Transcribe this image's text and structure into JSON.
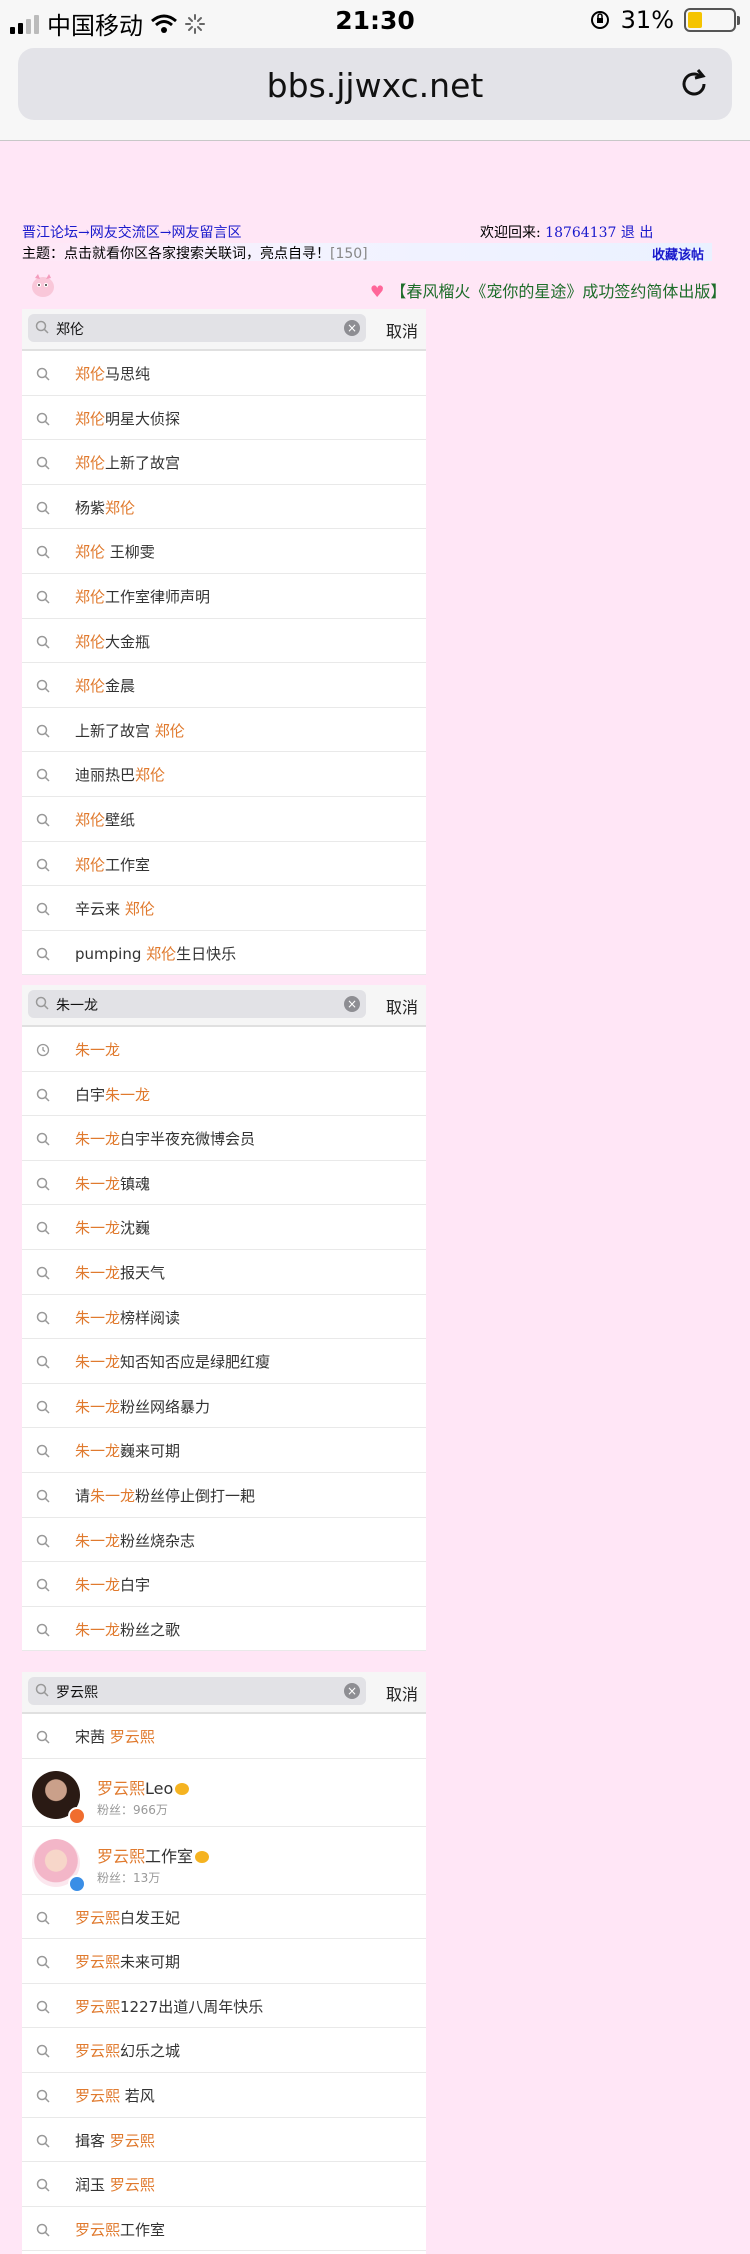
{
  "status_bar": {
    "carrier": "中国移动",
    "time": "21:30",
    "battery": "31%",
    "battery_level": 0.31
  },
  "browser": {
    "url": "bbs.jjwxc.net"
  },
  "forum": {
    "breadcrumb": "晋江论坛→网友交流区→网友留言区",
    "welcome_label": "欢迎回来:",
    "user_id": "18764137",
    "logout": "退 出",
    "topic": "主题：点击就看你区各家搜索关联词，亮点自寻！",
    "topic_count": "[150]",
    "favorite": "收藏该帖",
    "promo": "【春风榴火《宠你的星途》成功签约简体出版】"
  },
  "searches": [
    {
      "query": "郑伦",
      "cancel": "取消",
      "suggestions": [
        {
          "pre": "",
          "hl": "郑伦",
          "post": "马思纯",
          "icon": "search"
        },
        {
          "pre": "",
          "hl": "郑伦",
          "post": "明星大侦探",
          "icon": "search"
        },
        {
          "pre": "",
          "hl": "郑伦",
          "post": "上新了故宫",
          "icon": "search"
        },
        {
          "pre": "杨紫",
          "hl": "郑伦",
          "post": "",
          "icon": "search"
        },
        {
          "pre": "",
          "hl": "郑伦",
          "post": " 王柳雯",
          "icon": "search"
        },
        {
          "pre": "",
          "hl": "郑伦",
          "post": "工作室律师声明",
          "icon": "search"
        },
        {
          "pre": "",
          "hl": "郑伦",
          "post": "大金瓶",
          "icon": "search"
        },
        {
          "pre": "",
          "hl": "郑伦",
          "post": "金晨",
          "icon": "search"
        },
        {
          "pre": "上新了故宫 ",
          "hl": "郑伦",
          "post": "",
          "icon": "search"
        },
        {
          "pre": "迪丽热巴",
          "hl": "郑伦",
          "post": "",
          "icon": "search"
        },
        {
          "pre": "",
          "hl": "郑伦",
          "post": "壁纸",
          "icon": "search"
        },
        {
          "pre": "",
          "hl": "郑伦",
          "post": "工作室",
          "icon": "search"
        },
        {
          "pre": "辛云来 ",
          "hl": "郑伦",
          "post": "",
          "icon": "search"
        },
        {
          "pre": "pumping ",
          "hl": "郑伦",
          "post": "生日快乐",
          "icon": "search"
        }
      ]
    },
    {
      "query": "朱一龙",
      "cancel": "取消",
      "suggestions": [
        {
          "pre": "",
          "hl": "朱一龙",
          "post": "",
          "icon": "history"
        },
        {
          "pre": "白宇",
          "hl": "朱一龙",
          "post": "",
          "icon": "search"
        },
        {
          "pre": "",
          "hl": "朱一龙",
          "post": "白宇半夜充微博会员",
          "icon": "search"
        },
        {
          "pre": "",
          "hl": "朱一龙",
          "post": "镇魂",
          "icon": "search"
        },
        {
          "pre": "",
          "hl": "朱一龙",
          "post": "沈巍",
          "icon": "search"
        },
        {
          "pre": "",
          "hl": "朱一龙",
          "post": "报天气",
          "icon": "search"
        },
        {
          "pre": "",
          "hl": "朱一龙",
          "post": "榜样阅读",
          "icon": "search"
        },
        {
          "pre": "",
          "hl": "朱一龙",
          "post": "知否知否应是绿肥红瘦",
          "icon": "search"
        },
        {
          "pre": "",
          "hl": "朱一龙",
          "post": "粉丝网络暴力",
          "icon": "search"
        },
        {
          "pre": "",
          "hl": "朱一龙",
          "post": "巍来可期",
          "icon": "search"
        },
        {
          "pre": "请",
          "hl": "朱一龙",
          "post": "粉丝停止倒打一耙",
          "icon": "search"
        },
        {
          "pre": "",
          "hl": "朱一龙",
          "post": "粉丝烧杂志",
          "icon": "search"
        },
        {
          "pre": "",
          "hl": "朱一龙",
          "post": "白宇",
          "icon": "search"
        },
        {
          "pre": "",
          "hl": "朱一龙",
          "post": "粉丝之歌",
          "icon": "search"
        }
      ]
    },
    {
      "query": "罗云熙",
      "cancel": "取消",
      "suggestions_before": [
        {
          "pre": "宋茜 ",
          "hl": "罗云熙",
          "post": "",
          "icon": "search"
        }
      ],
      "users": [
        {
          "hl": "罗云熙",
          "tail": "Leo",
          "fans": "粉丝：966万",
          "avatar": "dark",
          "badge": "#f06d2f"
        },
        {
          "hl": "罗云熙",
          "tail": "工作室",
          "fans": "粉丝：13万",
          "avatar": "light",
          "badge": "#3a8ee6"
        }
      ],
      "suggestions": [
        {
          "pre": "",
          "hl": "罗云熙",
          "post": "白发王妃",
          "icon": "search"
        },
        {
          "pre": "",
          "hl": "罗云熙",
          "post": "未来可期",
          "icon": "search"
        },
        {
          "pre": "",
          "hl": "罗云熙",
          "post": "1227出道八周年快乐",
          "icon": "search"
        },
        {
          "pre": "",
          "hl": "罗云熙",
          "post": "幻乐之城",
          "icon": "search"
        },
        {
          "pre": "",
          "hl": "罗云熙",
          "post": " 若风",
          "icon": "search"
        },
        {
          "pre": "揖客 ",
          "hl": "罗云熙",
          "post": "",
          "icon": "search"
        },
        {
          "pre": "润玉 ",
          "hl": "罗云熙",
          "post": "",
          "icon": "search"
        },
        {
          "pre": "",
          "hl": "罗云熙",
          "post": "工作室",
          "icon": "search"
        }
      ]
    }
  ]
}
